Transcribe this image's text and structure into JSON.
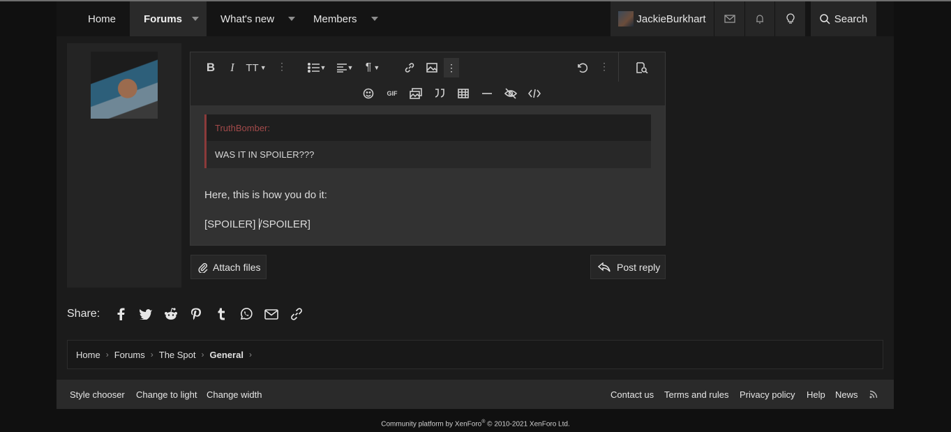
{
  "nav": {
    "home": "Home",
    "forums": "Forums",
    "whats_new": "What's new",
    "members": "Members",
    "username": "JackieBurkhart",
    "search": "Search"
  },
  "editor": {
    "quote_author": "TruthBomber:",
    "quote_text": "WAS IT IN SPOILER???",
    "line1": "Here, this is how you do it:",
    "line2_before": "[SPOILER] ",
    "line2_after": "/SPOILER]"
  },
  "actions": {
    "attach": "Attach files",
    "post_reply": "Post reply"
  },
  "share": {
    "label": "Share:"
  },
  "breadcrumb": [
    "Home",
    "Forums",
    "The Spot",
    "General"
  ],
  "footer": {
    "style_chooser": "Style chooser",
    "change_light": "Change to light",
    "change_width": "Change width",
    "contact": "Contact us",
    "terms": "Terms and rules",
    "privacy": "Privacy policy",
    "help": "Help",
    "news": "News",
    "copyright_main": "Community platform by XenForo",
    "copyright_reg": "®",
    "copyright_rest": " © 2010-2021 XenForo Ltd."
  }
}
